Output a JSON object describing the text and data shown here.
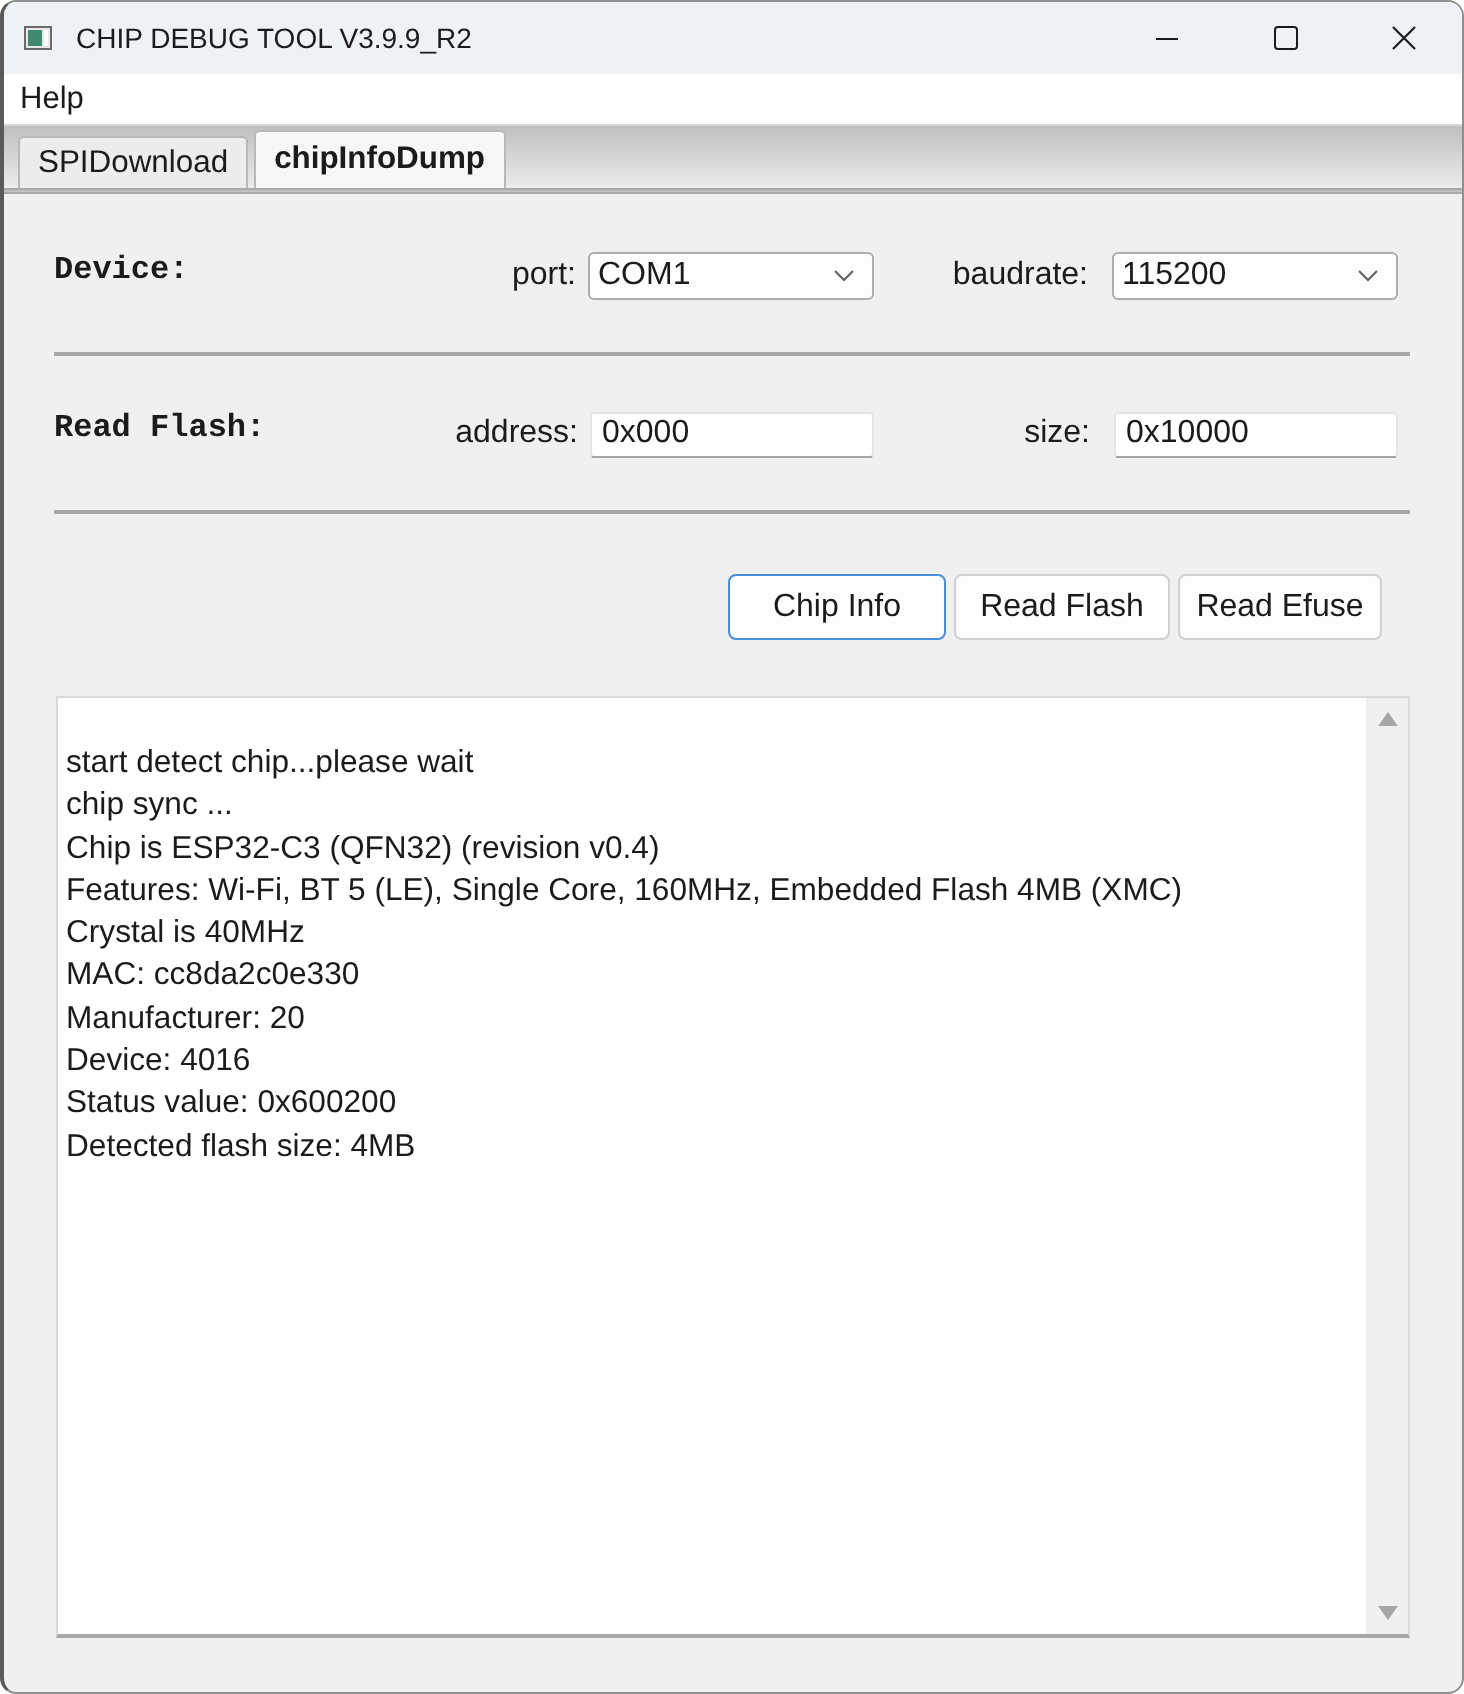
{
  "window": {
    "title": "CHIP DEBUG TOOL V3.9.9_R2"
  },
  "menu": [
    {
      "label": "Help"
    }
  ],
  "tabs": [
    {
      "label": "SPIDownload",
      "selected": false
    },
    {
      "label": "chipInfoDump",
      "selected": true
    }
  ],
  "sections": [
    {
      "heading": "Device:",
      "fields": [
        {
          "kind": "dropdown",
          "label": "port:",
          "value": "COM1"
        },
        {
          "kind": "dropdown",
          "label": "baudrate:",
          "value": "115200"
        }
      ]
    },
    {
      "heading": "Read Flash:",
      "fields": [
        {
          "kind": "input",
          "label": "address:",
          "value": "0x000"
        },
        {
          "kind": "input",
          "label": "size:",
          "value": "0x10000"
        }
      ]
    }
  ],
  "buttons": [
    {
      "label": "Chip Info",
      "focused": true
    },
    {
      "label": "Read Flash",
      "focused": false
    },
    {
      "label": "Read Efuse",
      "focused": false
    }
  ],
  "log": {
    "lines": [
      "start detect chip...please wait",
      "chip sync ...",
      "Chip is ESP32-C3 (QFN32) (revision v0.4)",
      "Features: Wi-Fi, BT 5 (LE), Single Core, 160MHz, Embedded Flash 4MB (XMC)",
      "Crystal is 40MHz",
      "MAC: cc8da2c0e330",
      "Manufacturer: 20",
      "Device: 4016",
      "Status value: 0x600200",
      "Detected flash size: 4MB"
    ]
  }
}
